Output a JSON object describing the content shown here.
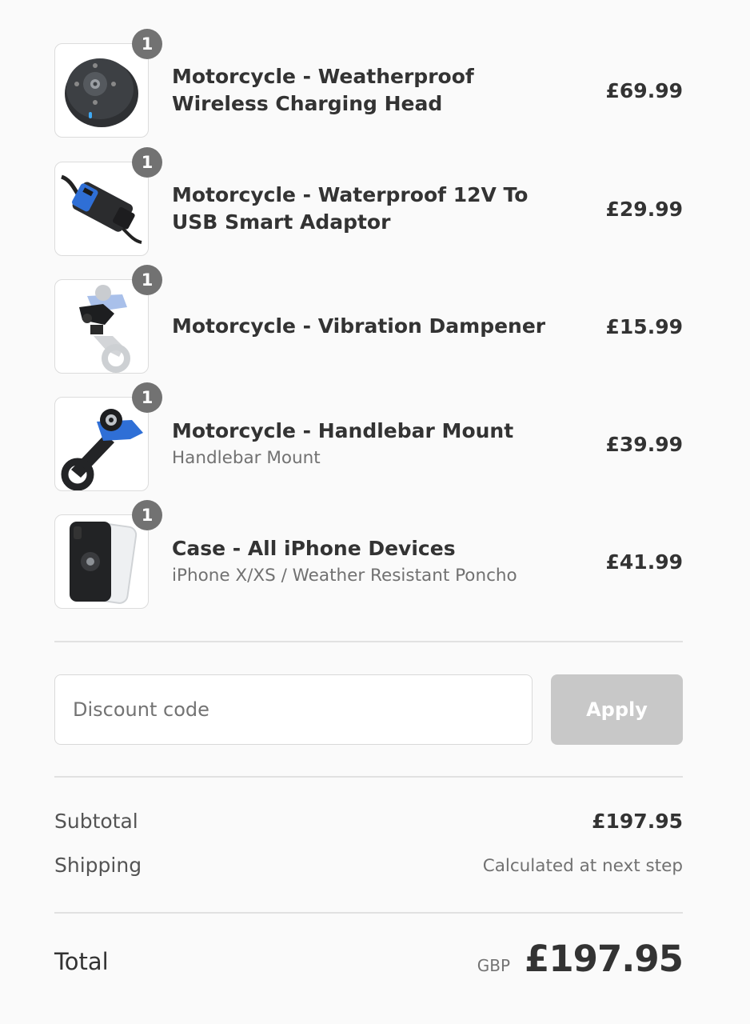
{
  "products": [
    {
      "quantity": "1",
      "name": "Motorcycle - Weatherproof Wireless Charging Head",
      "variant": "",
      "price": "£69.99",
      "image_icon": "wireless-charging-head-image"
    },
    {
      "quantity": "1",
      "name": "Motorcycle - Waterproof 12V To USB Smart Adaptor",
      "variant": "",
      "price": "£29.99",
      "image_icon": "usb-adaptor-image"
    },
    {
      "quantity": "1",
      "name": "Motorcycle - Vibration Dampener",
      "variant": "",
      "price": "£15.99",
      "image_icon": "vibration-dampener-image"
    },
    {
      "quantity": "1",
      "name": "Motorcycle - Handlebar Mount",
      "variant": "Handlebar Mount",
      "price": "£39.99",
      "image_icon": "handlebar-mount-image"
    },
    {
      "quantity": "1",
      "name": "Case - All iPhone Devices",
      "variant": "iPhone X/XS / Weather Resistant Poncho",
      "price": "£41.99",
      "image_icon": "iphone-case-image"
    }
  ],
  "discount": {
    "placeholder": "Discount code",
    "value": "",
    "apply_label": "Apply"
  },
  "summary": {
    "subtotal_label": "Subtotal",
    "subtotal_value": "£197.95",
    "shipping_label": "Shipping",
    "shipping_value": "Calculated at next step",
    "total_label": "Total",
    "currency": "GBP",
    "total_value": "£197.95"
  },
  "colors": {
    "background": "#fafafa",
    "badge": "#727272",
    "apply_disabled": "#c8c8c8",
    "accent_blue": "#4a72c4"
  }
}
